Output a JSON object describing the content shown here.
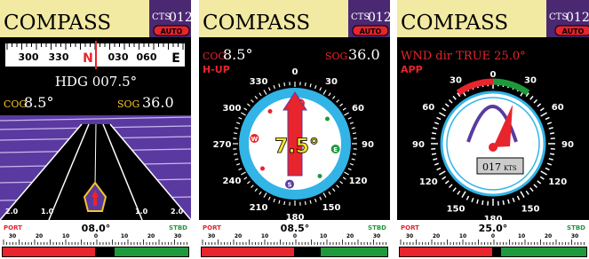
{
  "colors": {
    "header_bg": "#f2e9a2",
    "cts_bg": "#4b2872",
    "auto_badge": "#e8242c",
    "screen_bg": "#000000",
    "accent_red": "#e8242c",
    "accent_green": "#1e9a3c",
    "accent_purple": "#5a3aa0",
    "dial_cyan": "#32b4e6"
  },
  "panels": [
    {
      "title": "COMPASS",
      "cts_label": "CTS",
      "cts_value": "012°",
      "auto_label": "AUTO",
      "strip": {
        "labels": [
          "300",
          "330",
          "N",
          "030",
          "060",
          "E"
        ]
      },
      "hdg_text": "HDG 007.5°",
      "cog_label": "COG",
      "cog_value": "8.5°",
      "sog_label": "SOG",
      "sog_value": "36.0",
      "road": {
        "labels": [
          "2.0",
          "1.0",
          "1.0",
          "2.0"
        ]
      },
      "bottom": {
        "port": "PORT",
        "stbd": "STBD",
        "value": "08.0°",
        "scale": [
          "30",
          "20",
          "10",
          "0",
          "10",
          "20",
          "30"
        ]
      }
    },
    {
      "title": "COMPASS",
      "cts_label": "CTS",
      "cts_value": "012°",
      "auto_label": "AUTO",
      "cog_label": "COG",
      "cog_value": "8.5°",
      "sog_label": "SOG",
      "sog_value": "36.0",
      "mode": "H-UP",
      "dial": {
        "labels": [
          "0",
          "30",
          "60",
          "90",
          "120",
          "150",
          "180",
          "210",
          "240",
          "270",
          "300",
          "330"
        ],
        "center_value": "7.5°",
        "cardinals": [
          "N",
          "E",
          "S",
          "W"
        ]
      },
      "bottom": {
        "port": "PORT",
        "stbd": "STBD",
        "value": "08.5°",
        "scale": [
          "30",
          "20",
          "10",
          "0",
          "10",
          "20",
          "30"
        ]
      }
    },
    {
      "title": "COMPASS",
      "cts_label": "CTS",
      "cts_value": "012°",
      "auto_label": "AUTO",
      "wind_text": "WND dir TRUE 25.0°",
      "mode": "APP",
      "dial": {
        "labels": [
          "0",
          "30",
          "30",
          "60",
          "60",
          "90",
          "90",
          "120",
          "120",
          "150",
          "150",
          "180"
        ],
        "speed_value": "017",
        "speed_unit": "KTS"
      },
      "bottom": {
        "port": "PORT",
        "stbd": "STBD",
        "value": "25.0°",
        "scale": [
          "30",
          "20",
          "10",
          "0",
          "10",
          "20",
          "30"
        ]
      }
    }
  ]
}
